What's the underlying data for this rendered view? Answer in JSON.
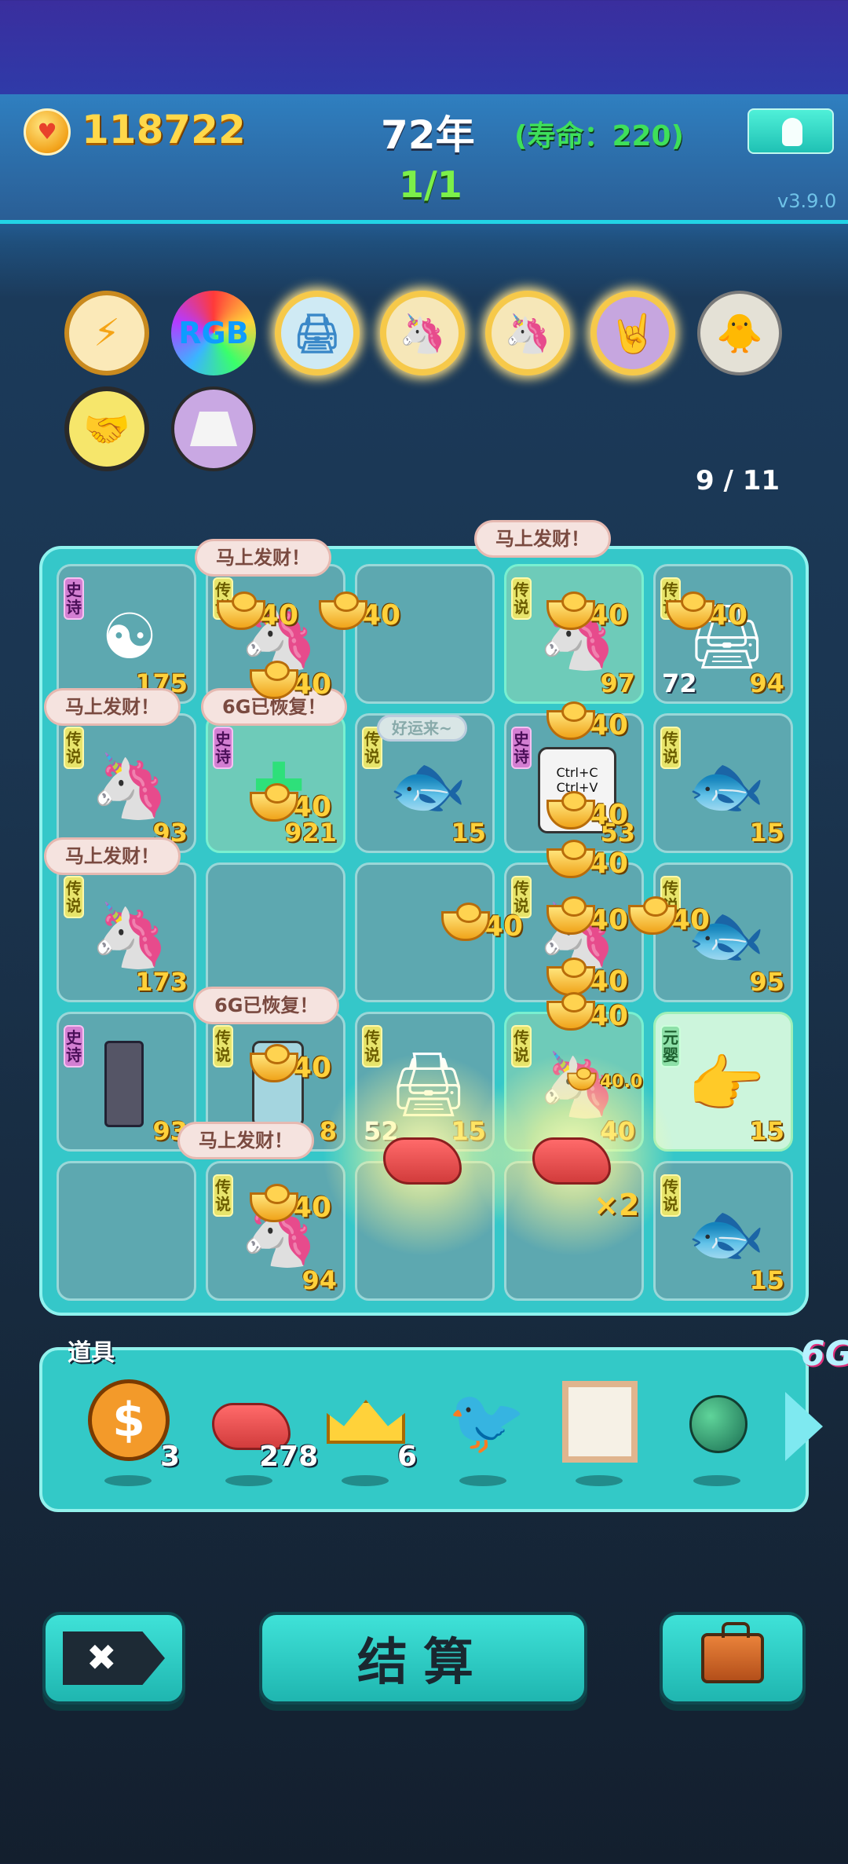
{
  "header": {
    "coins": "118722",
    "year": "72年",
    "life": "(寿命：220)",
    "progress": "1/1",
    "version": "v3.9.0"
  },
  "badges": {
    "count": "9 / 11",
    "icons": [
      "lightning-icon",
      "rgb-icon",
      "printer-icon",
      "unicorn-icon",
      "unicorn-icon",
      "rock-hand-icon",
      "chick-egg-icon",
      "handshake-icon",
      "skirt-icon"
    ],
    "rgb_text": "RGB"
  },
  "board": {
    "cells": [
      {
        "tag": "史诗",
        "value": "175",
        "icon": "bagua-icon"
      },
      {
        "tag": "传说",
        "value": "",
        "icon": "unicorn-icon"
      },
      {
        "tag": "",
        "value": "",
        "icon": ""
      },
      {
        "tag": "传说",
        "value": "97",
        "icon": "unicorn-icon"
      },
      {
        "tag": "传说",
        "value": "94",
        "value2": "72",
        "icon": "printer-icon"
      },
      {
        "tag": "传说",
        "value": "93",
        "icon": "unicorn-icon"
      },
      {
        "tag": "史诗",
        "value": "921",
        "icon": "virus-icon"
      },
      {
        "tag": "传说",
        "value": "15",
        "icon": "koi-fish-icon"
      },
      {
        "tag": "史诗",
        "value": "53",
        "icon": "ctrl-cv-icon",
        "text": "Ctrl+C Ctrl+V"
      },
      {
        "tag": "传说",
        "value": "15",
        "icon": "koi-fish-icon"
      },
      {
        "tag": "传说",
        "value": "173",
        "icon": "unicorn-icon"
      },
      {
        "tag": "",
        "value": "",
        "icon": ""
      },
      {
        "tag": "",
        "value": "",
        "icon": ""
      },
      {
        "tag": "传说",
        "value": "",
        "icon": "unicorn-icon"
      },
      {
        "tag": "传说",
        "value": "95",
        "icon": "koi-fish-icon"
      },
      {
        "tag": "史诗",
        "value": "93",
        "icon": "gpu-icon"
      },
      {
        "tag": "传说",
        "value": "8",
        "icon": "phone-icon"
      },
      {
        "tag": "传说",
        "value": "15",
        "value2": "52",
        "icon": "printer-icon"
      },
      {
        "tag": "传说",
        "value": "40",
        "icon": "unicorn-icon"
      },
      {
        "tag": "元婴",
        "value": "15",
        "icon": "pointing-hand-icon"
      },
      {
        "tag": "",
        "value": "",
        "icon": ""
      },
      {
        "tag": "传说",
        "value": "94",
        "icon": "unicorn-icon"
      },
      {
        "tag": "",
        "value": "",
        "icon": "liver-icon"
      },
      {
        "tag": "",
        "value": "",
        "icon": "liver-icon"
      },
      {
        "tag": "传说",
        "value": "15",
        "icon": "koi-fish-icon"
      }
    ],
    "bubbles": {
      "fortune": "马上发财！",
      "recover": "6G已恢复！",
      "luck": "好运来~"
    },
    "gain": "40",
    "gain_small": "40.0",
    "multiplier": "×2"
  },
  "items": {
    "label": "道具",
    "list": [
      {
        "icon": "dollar-coin-icon",
        "count": "3"
      },
      {
        "icon": "liver-icon",
        "count": "278"
      },
      {
        "icon": "crown-icon",
        "count": "6"
      },
      {
        "icon": "white-bird-icon",
        "count": ""
      },
      {
        "icon": "frame-icon",
        "count": ""
      },
      {
        "icon": "green-orb-icon",
        "count": ""
      }
    ],
    "tag": "6G"
  },
  "buttons": {
    "settle": "结算"
  },
  "colors": {
    "accent": "#35c7c9",
    "gold": "#ffd13a",
    "green": "#3ee05a"
  }
}
